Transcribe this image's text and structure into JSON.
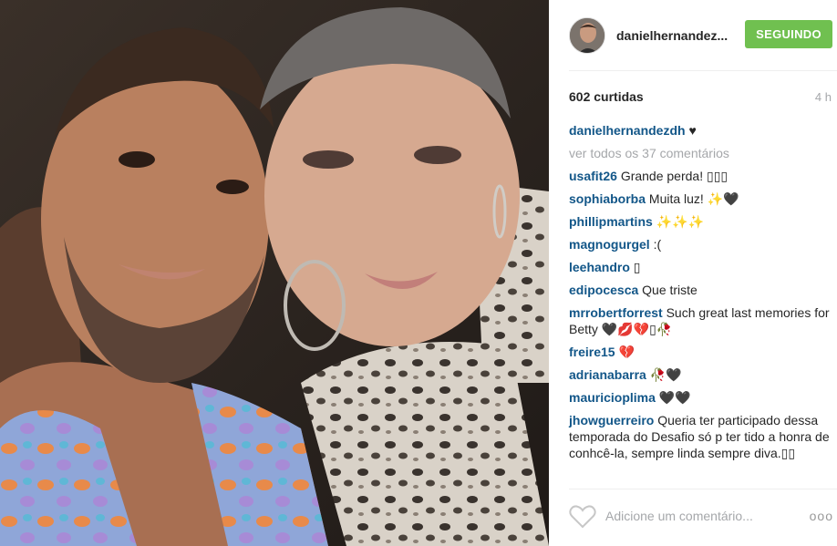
{
  "post": {
    "username": "danielhernandez...",
    "follow_label": "SEGUINDO",
    "likes": "602 curtidas",
    "time": "4 h",
    "caption_user": "danielhernandezdh",
    "caption_text": "♥",
    "view_all": "ver todos os 37 comentários",
    "add_comment_placeholder": "Adicione um comentário...",
    "more_options": "ooo"
  },
  "comments": [
    {
      "user": "usafit26",
      "text": "Grande perda! ▯▯▯"
    },
    {
      "user": "sophiaborba",
      "text": "Muita luz! ✨🖤"
    },
    {
      "user": "phillipmartins",
      "text": "✨✨✨"
    },
    {
      "user": "magnogurgel",
      "text": ":("
    },
    {
      "user": "leehandro",
      "text": "▯"
    },
    {
      "user": "edipocesca",
      "text": "Que triste"
    },
    {
      "user": "mrrobertforrest",
      "text": "Such great last memories for Betty 🖤💋💔▯🥀"
    },
    {
      "user": "freire15",
      "text": "💔"
    },
    {
      "user": "adrianabarra",
      "text": "🥀🖤"
    },
    {
      "user": "mauricioplima",
      "text": "🖤🖤"
    },
    {
      "user": "jhowguerreiro",
      "text": "Queria ter participado dessa temporada do Desafio só p ter tido a honra de conhcê-la, sempre linda sempre diva.▯▯"
    }
  ],
  "colors": {
    "follow": "#70c050",
    "username": "#125688",
    "muted": "#a5a7aa"
  },
  "icons": {
    "like": "heart-outline-icon",
    "more": "ellipsis-icon"
  }
}
